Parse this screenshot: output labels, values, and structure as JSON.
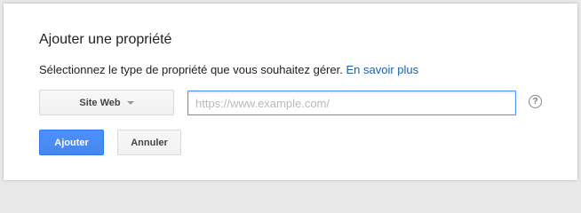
{
  "dialog": {
    "title": "Ajouter une propriété",
    "description": "Sélectionnez le type de propriété que vous souhaitez gérer.",
    "learn_more_link": "En savoir plus",
    "property_type": {
      "selected": "Site Web"
    },
    "url_input": {
      "value": "",
      "placeholder": "https://www.example.com/"
    },
    "help_icon": "question-circle-icon",
    "help_glyph": "?",
    "buttons": {
      "add": "Ajouter",
      "cancel": "Annuler"
    }
  },
  "colors": {
    "primary_button": "#4d90fe",
    "link": "#1a5fb4",
    "input_focus_border": "#4d90fe"
  }
}
